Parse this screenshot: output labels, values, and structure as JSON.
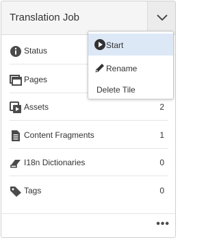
{
  "header": {
    "title": "Translation Job"
  },
  "rows": [
    {
      "label": "Status",
      "count": "",
      "icon": "info-icon"
    },
    {
      "label": "Pages",
      "count": "",
      "icon": "pages-icon"
    },
    {
      "label": "Assets",
      "count": "2",
      "icon": "assets-icon"
    },
    {
      "label": "Content Fragments",
      "count": "1",
      "icon": "content-fragment-icon"
    },
    {
      "label": "I18n Dictionaries",
      "count": "0",
      "icon": "dictionary-icon"
    },
    {
      "label": "Tags",
      "count": "0",
      "icon": "tag-icon"
    }
  ],
  "menu": {
    "items": [
      {
        "label": "Start",
        "icon": "play-icon",
        "highlighted": true
      },
      {
        "label": "Rename",
        "icon": "pencil-icon"
      },
      {
        "label": "Delete Tile"
      }
    ]
  },
  "footer": {
    "more_label": "•••"
  },
  "colors": {
    "menu_highlight": "#dde8f6",
    "header_bg": "#f5f5f5"
  }
}
